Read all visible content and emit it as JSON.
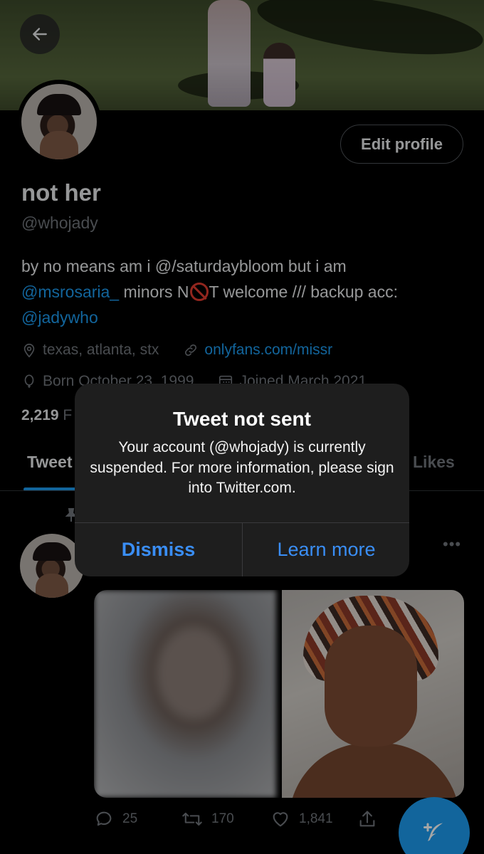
{
  "header": {
    "back_icon": "arrow-left-icon"
  },
  "profile": {
    "edit_label": "Edit profile",
    "display_name": "not her",
    "handle": "@whojady",
    "bio": {
      "part1": "by no means am i @/saturdaybloom but i am",
      "mention1": "@msrosaria_",
      "part2": " minors N",
      "part3": "T welcome /// backup acc:",
      "mention2": "@jadywho"
    },
    "location": "texas, atlanta, stx",
    "website": "onlyfans.com/missr",
    "born": "Born October 23, 1999",
    "joined": "Joined March 2021",
    "following_count": "2,219",
    "following_label": "F"
  },
  "tabs": {
    "tweets": "Tweet",
    "likes": "Likes"
  },
  "tweet": {
    "replies": "25",
    "retweets": "170",
    "likes": "1,841"
  },
  "alert": {
    "title": "Tweet not sent",
    "message": "Your account (@whojady) is currently suspended. For more information, please sign into Twitter.com.",
    "dismiss": "Dismiss",
    "learn_more": "Learn more"
  },
  "colors": {
    "accent": "#1d9bf0",
    "alert_button": "#3a8ef5",
    "muted": "#71767b"
  }
}
